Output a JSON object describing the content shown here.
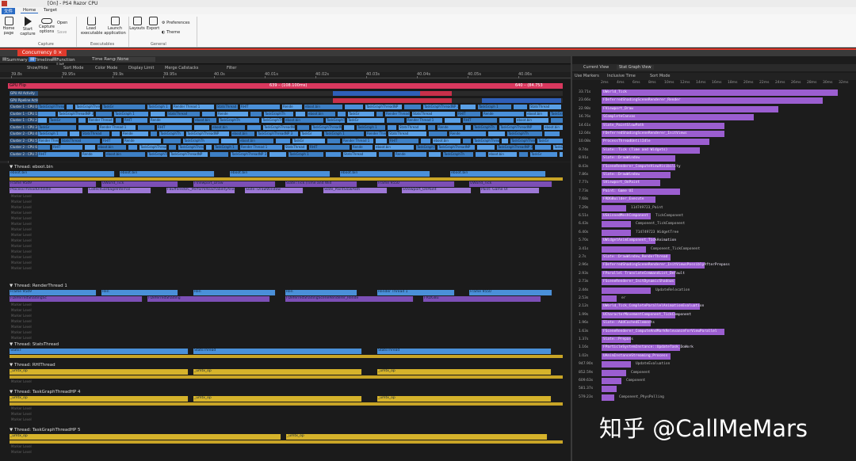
{
  "window": {
    "title": "[On] - PS4 Razor CPU"
  },
  "menu": {
    "tabs": [
      "文件",
      "Home",
      "Target"
    ]
  },
  "ribbon": {
    "buttons": [
      {
        "l1": "Home",
        "l2": "page"
      },
      {
        "l1": "Start",
        "l2": "capture"
      },
      {
        "l1": "Capture",
        "l2": "options"
      },
      {
        "l1": "Load",
        "l2": "executable"
      },
      {
        "l1": "Launch",
        "l2": "application"
      },
      {
        "l1": "Layouts",
        "l2": ""
      },
      {
        "l1": "Export",
        "l2": ""
      }
    ],
    "small": {
      "open": "Open",
      "save": "Save",
      "preferences": "Preferences",
      "theme": "Theme"
    },
    "groups": [
      "Capture",
      "Executables",
      "General"
    ]
  },
  "doc_tab": "Concurrency 0",
  "toolbar": {
    "items": [
      "Summary",
      "Timeline",
      "Function List",
      "Time Range:",
      "None"
    ]
  },
  "toolbar2": {
    "items": [
      "Show/Hide",
      "Sort Mode",
      "Color Mode",
      "Display Limit",
      "Merge Callstacks",
      "Filter"
    ]
  },
  "ruler": {
    "ticks": [
      "39.8s",
      "39.95s",
      "39.9s",
      "39.95s",
      "40.0s",
      "40.01s",
      "40.02s",
      "40.03s",
      "40.04s",
      "40.05s",
      "40.06s"
    ]
  },
  "overview": {
    "gpu_flip": "GPU Flip",
    "gpu_hit": "639 – (108.100ms)",
    "gpu_hit_right": "640 – (84.753",
    "lanes": [
      "GPU All Activity",
      "GPU Pipeline Activity",
      "Cluster 1 - CPU 0",
      "Cluster 1 - CPU 1",
      "Cluster 1 - CPU 2",
      "Cluster 1 - CPU 3",
      "Cluster 2 - CPU 4",
      "Cluster 2 - CPU 5",
      "Cluster 2 - CPU 6",
      "Cluster 2 - CPU 7"
    ],
    "block_labels": [
      "eboot.bin",
      "TaskGraphTh",
      "TaskGraphThreadNP",
      "eboot.bin",
      "TaskGraphThreadNP 3",
      "TaskGr",
      "TaskGraph 1",
      "Render Thread 1",
      "StatsThread",
      "RHIT",
      "Rende"
    ]
  },
  "threads": [
    {
      "name": "Thread: eboot.bin",
      "rows": [
        [
          "eboot.bin",
          "eboot.bin",
          "eboot.bin",
          "eboot.bin",
          "eboot.bin"
        ],
        [
          "Frame 9549",
          "UWorld_Tick",
          "FViewport_Draw",
          "Slate::Tick (Time and Wid",
          "Frame 9550",
          "UWorld_Tick"
        ],
        [
          "ProcessThreadUntilIdle",
          "CollectGarbageInternal",
          "FBufferedOC_PerformReachabilityAnalysis",
          "Slate::DrawWindow",
          "Slate_PaintSlowPath",
          "SViewport_OnPaint",
          "Paint: Game UI"
        ]
      ]
    },
    {
      "name": "Thread: RenderThread 1",
      "rows": [
        [
          "Frame 9549",
          "Ren",
          "Ren",
          "Ren",
          "Render Thread 1",
          "Frame 9550"
        ],
        [
          "FDeferredShadingSc",
          "FDeferredShading",
          "FDeferredShadingSceneRenderer_Rende",
          "FRDGBu"
        ]
      ]
    },
    {
      "name": "Thread: StatsThread",
      "rows": [
        [
          "StatsT",
          "StatsThread",
          "StatsThread"
        ]
      ]
    },
    {
      "name": "Thread: RHIThread",
      "rows": [
        [
          "_umtx_op",
          "_umtx_op",
          "_umtx_op"
        ]
      ]
    },
    {
      "name": "Thread: TaskGraphThreadHP 4",
      "rows": [
        [
          "_umtx_op",
          "_umtx_op",
          "_umtx_op"
        ]
      ]
    },
    {
      "name": "Thread: TaskGraphThreadHP 5",
      "rows": [
        [
          "_umtx_op",
          "_umtx_op"
        ]
      ]
    }
  ],
  "marker_label": "Marker Level",
  "right": {
    "tabs": [
      "Current View",
      "Stat Graph View"
    ],
    "tool": [
      "Use Markers",
      "Inclusive Time",
      "Sort Mode"
    ],
    "axis": [
      "2ms",
      "4ms",
      "6ms",
      "8ms",
      "10ms",
      "12ms",
      "14ms",
      "16ms",
      "18ms",
      "20ms",
      "22ms",
      "24ms",
      "26ms",
      "28ms",
      "30ms",
      "32ms"
    ],
    "rows": [
      {
        "v": "33.71s",
        "pct": 0.96,
        "n": "UWorld_Tick"
      },
      {
        "v": "23.66s",
        "pct": 0.9,
        "n": "FDeferredShadingSceneRenderer_Render"
      },
      {
        "v": "22.98s",
        "pct": 0.72,
        "n": "FViewport_Draw"
      },
      {
        "v": "16.76s",
        "pct": 0.62,
        "n": "SCompleteCanvas"
      },
      {
        "v": "14.61s",
        "pct": 0.5,
        "n": "Slate_PaintSlowPath"
      },
      {
        "v": "12.04s",
        "pct": 0.5,
        "n": "FDeferredShadingSceneRenderer_InitViews"
      },
      {
        "v": "10.08s",
        "pct": 0.44,
        "n": "ProcessThreadUntilIdle"
      },
      {
        "v": "9.74s",
        "pct": 0.4,
        "n": "Slate::Tick (Time and Widgets)"
      },
      {
        "v": "8.91s",
        "pct": 0.3,
        "n": "Slate::DrawWindow"
      },
      {
        "v": "8.43s",
        "pct": 0.3,
        "n": "FSceneRenderer_ComputeViewVisibility"
      },
      {
        "v": "7.86s",
        "pct": 0.28,
        "n": "Slate::DrawWindow"
      },
      {
        "v": "7.77s",
        "pct": 0.24,
        "n": "SViewport_OnPaint"
      },
      {
        "v": "7.73s",
        "pct": 0.32,
        "n": "Paint: Game UI"
      },
      {
        "v": "7.68s",
        "pct": 0.22,
        "n": "FRDGBuilder_Execute"
      },
      {
        "v": "7.29s",
        "pct": 0.1,
        "n": "",
        "ext": "114749723_Paint"
      },
      {
        "v": "6.51s",
        "pct": 0.2,
        "n": "USkinnedMeshComponent",
        "ext": "TickComponent"
      },
      {
        "v": "6.43s",
        "pct": 0.12,
        "n": "",
        "ext": "Component_TickComponent"
      },
      {
        "v": "6.40s",
        "pct": 0.12,
        "n": "",
        "ext": "714749723 WidgetTree"
      },
      {
        "v": "5.70s",
        "pct": 0.22,
        "n": "UWidgetAnimComponent_TickAnimation"
      },
      {
        "v": "3.41s",
        "pct": 0.18,
        "n": "",
        "ext": "Component_TickComponent"
      },
      {
        "v": "2.7s",
        "pct": 0.28,
        "n": "Slate::DrawWindow_RenderThread"
      },
      {
        "v": "2.96s",
        "pct": 0.42,
        "n": "FDeferredShadingSceneRenderer_InitViewsPossiblyAfterPrepass"
      },
      {
        "v": "2.93s",
        "pct": 0.3,
        "n": "FParallel TranslateCommandList_Default"
      },
      {
        "v": "2.73s",
        "pct": 0.3,
        "n": "FSceneRenderer_InitDynamicShadows"
      },
      {
        "v": "2.44s",
        "pct": 0.2,
        "n": "",
        "ext": "UpdateRelocation"
      },
      {
        "v": "2.53s",
        "pct": 0.06,
        "n": "",
        "ext": "er"
      },
      {
        "v": "2.12s",
        "pct": 0.4,
        "n": "UWorld_Tick_CompleteParallelAnimationEvaluation"
      },
      {
        "v": "1.99s",
        "pct": 0.3,
        "n": "UCharacterMovementComponent_TickComponent"
      },
      {
        "v": "1.96s",
        "pct": 0.2,
        "n": "Slate::AddCachedElements"
      },
      {
        "v": "1.63s",
        "pct": 0.5,
        "n": "FSceneRenderer_ComputeAndMarkRelevanceForViewParallel"
      },
      {
        "v": "1.37s",
        "pct": 0.12,
        "n": "Slate::Prepass"
      },
      {
        "v": "1.16s",
        "pct": 0.32,
        "n": "FParticleSystemInstance::UpdateTask_DoWork"
      },
      {
        "v": "1.02s",
        "pct": 0.28,
        "n": "UAnimInstanceStreaming_Process"
      },
      {
        "v": "947.90s",
        "pct": 0.12,
        "n": "",
        "ext": "UpdateEvaluation"
      },
      {
        "v": "852.59s",
        "pct": 0.1,
        "n": "",
        "ext": "Component"
      },
      {
        "v": "609.63s",
        "pct": 0.08,
        "n": "",
        "ext": "Component"
      },
      {
        "v": "581.37s",
        "pct": 0.06,
        "n": "",
        "ext": ""
      },
      {
        "v": "579.23s",
        "pct": 0.05,
        "n": "",
        "ext": "Component_PhysPolling"
      }
    ]
  },
  "watermark": "知乎 @CallMeMars"
}
